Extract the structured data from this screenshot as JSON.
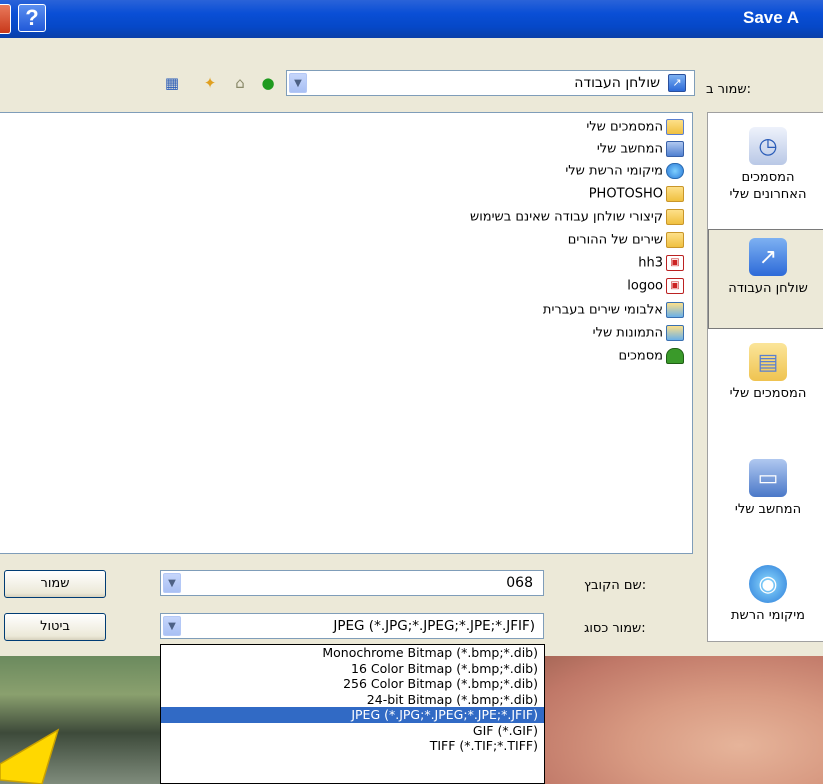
{
  "window": {
    "title": "Save A",
    "help_label": "?"
  },
  "save_in": {
    "label": "שמור ב:",
    "value": "שולחן העבודה"
  },
  "places": [
    {
      "label_line1": "המסמכים",
      "label_line2": "האחרונים שלי",
      "icon": "recent-documents-icon"
    },
    {
      "label_line1": "שולחן העבודה",
      "label_line2": "",
      "icon": "desktop-icon"
    },
    {
      "label_line1": "המסמכים שלי",
      "label_line2": "",
      "icon": "my-documents-icon"
    },
    {
      "label_line1": "המחשב שלי",
      "label_line2": "",
      "icon": "my-computer-icon"
    },
    {
      "label_line1": "מיקומי הרשת",
      "label_line2": "",
      "icon": "network-places-icon"
    }
  ],
  "files": [
    {
      "name": "המסמכים שלי",
      "icon": "my-documents-icon",
      "glyph": ""
    },
    {
      "name": "המחשב שלי",
      "icon": "my-computer-icon",
      "glyph": ""
    },
    {
      "name": "מיקומי הרשת שלי",
      "icon": "network-places-icon",
      "glyph": ""
    },
    {
      "name": "PHOTOSHO",
      "icon": "folder-icon",
      "glyph": ""
    },
    {
      "name": "קיצורי שולחן עבודה שאינם בשימוש",
      "icon": "folder-icon",
      "glyph": ""
    },
    {
      "name": "שירים של ההורים",
      "icon": "folder-icon",
      "glyph": ""
    },
    {
      "name": "hh3",
      "icon": "image-file-icon",
      "glyph": "▣"
    },
    {
      "name": "logoo",
      "icon": "image-file-icon",
      "glyph": "▣"
    },
    {
      "name": "אלבומי שירים בעברית",
      "icon": "album-shortcut-icon",
      "glyph": ""
    },
    {
      "name": "התמונות שלי",
      "icon": "album-shortcut-icon",
      "glyph": ""
    },
    {
      "name": "מסמכים",
      "icon": "tree-shortcut-icon",
      "glyph": ""
    }
  ],
  "file_name": {
    "label": "שם הקובץ:",
    "value": "068"
  },
  "save_as_type": {
    "label": "שמור כסוג:",
    "value": "JPEG (*.JPG;*.JPEG;*.JPE;*.JFIF)"
  },
  "buttons": {
    "save": "שמור",
    "cancel": "ביטול"
  },
  "file_types": [
    "Monochrome Bitmap (*.bmp;*.dib)",
    "16 Color Bitmap (*.bmp;*.dib)",
    "256 Color Bitmap (*.bmp;*.dib)",
    "24-bit Bitmap (*.bmp;*.dib)",
    "JPEG (*.JPG;*.JPEG;*.JPE;*.JFIF)",
    "GIF (*.GIF)",
    "TIFF (*.TIF;*.TIFF)"
  ],
  "selected_file_type_index": 4,
  "colors": {
    "titlebar": "#0548c8",
    "selection": "#316ac5",
    "dialog_bg": "#ece9d8",
    "pointer_arrow": "#ffd800"
  }
}
